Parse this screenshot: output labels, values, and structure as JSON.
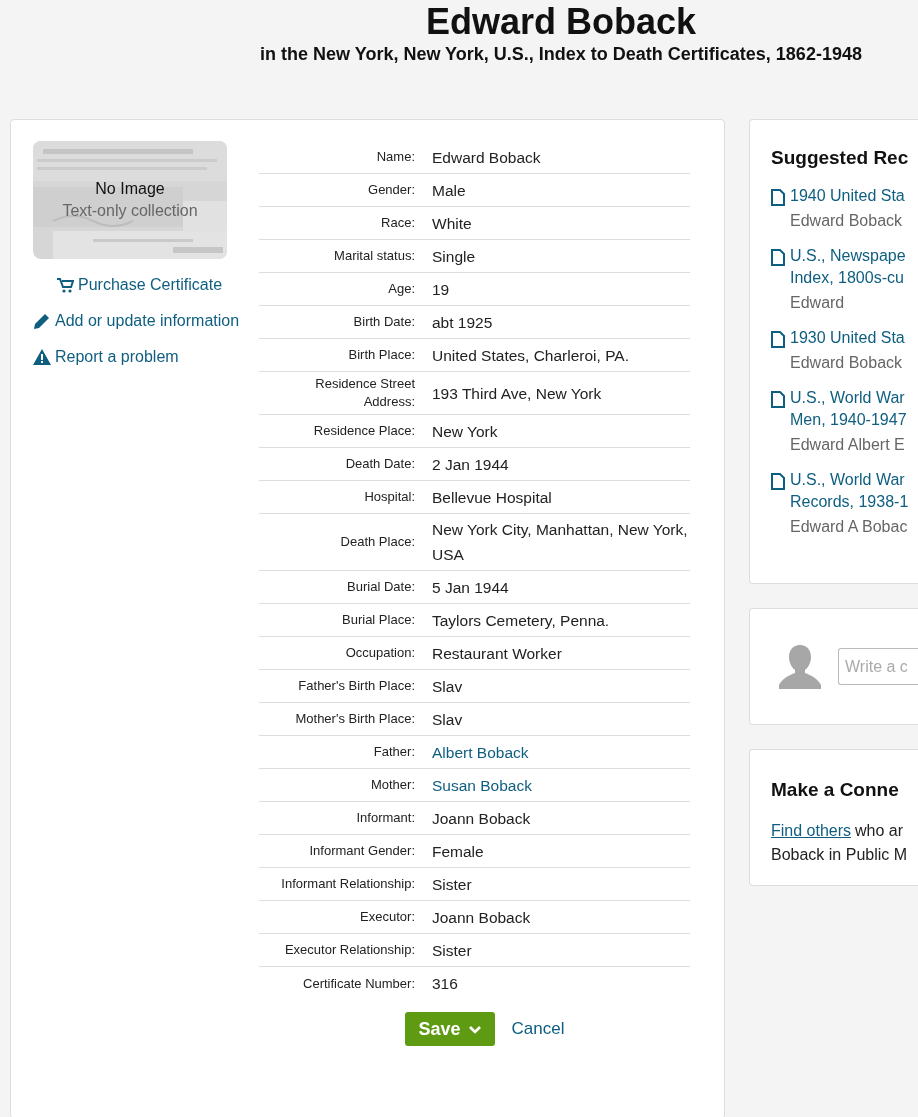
{
  "header": {
    "title": "Edward Boback",
    "subtitle": "in the New York, New York, U.S., Index to Death Certificates, 1862-1948"
  },
  "image": {
    "kind": "picture",
    "title": "No Image",
    "caption": "Text-only collection"
  },
  "actions": [
    {
      "label": "Purchase Certificate"
    },
    {
      "label": "Add or update information"
    },
    {
      "label": "Report a problem"
    }
  ],
  "fields": [
    {
      "label": "Name:",
      "value": "Edward Boback",
      "link": false
    },
    {
      "label": "Gender:",
      "value": "Male",
      "link": false
    },
    {
      "label": "Race:",
      "value": "White",
      "link": false
    },
    {
      "label": "Marital status:",
      "value": "Single",
      "link": false
    },
    {
      "label": "Age:",
      "value": "19",
      "link": false
    },
    {
      "label": "Birth Date:",
      "value": "abt 1925",
      "link": false
    },
    {
      "label": "Birth Place:",
      "value": "United States, Charleroi, PA.",
      "link": false
    },
    {
      "label": "Residence Street Address:",
      "value": "193 Third Ave, New York",
      "link": false
    },
    {
      "label": "Residence Place:",
      "value": "New York",
      "link": false
    },
    {
      "label": "Death Date:",
      "value": "2 Jan 1944",
      "link": false
    },
    {
      "label": "Hospital:",
      "value": "Bellevue Hospital",
      "link": false
    },
    {
      "label": "Death Place:",
      "value": "New York City, Manhattan, New York, USA",
      "link": false
    },
    {
      "label": "Burial Date:",
      "value": "5 Jan 1944",
      "link": false
    },
    {
      "label": "Burial Place:",
      "value": "Taylors Cemetery, Penna.",
      "link": false
    },
    {
      "label": "Occupation:",
      "value": "Restaurant Worker",
      "link": false
    },
    {
      "label": "Father's Birth Place:",
      "value": "Slav",
      "link": false
    },
    {
      "label": "Mother's Birth Place:",
      "value": "Slav",
      "link": false
    },
    {
      "label": "Father:",
      "value": "Albert Boback",
      "link": true
    },
    {
      "label": "Mother:",
      "value": "Susan Boback",
      "link": true
    },
    {
      "label": "Informant:",
      "value": "Joann Boback",
      "link": false
    },
    {
      "label": "Informant Gender:",
      "value": "Female",
      "link": false
    },
    {
      "label": "Informant Relationship:",
      "value": "Sister",
      "link": false
    },
    {
      "label": "Executor:",
      "value": "Joann Boback",
      "link": false
    },
    {
      "label": "Executor Relationship:",
      "value": "Sister",
      "link": false
    },
    {
      "label": "Certificate Number:",
      "value": "316",
      "link": false
    }
  ],
  "buttons": {
    "save": "Save",
    "cancel": "Cancel"
  },
  "suggested": {
    "title": "Suggested Rec",
    "records": [
      {
        "title_lines": [
          "1940 United Sta"
        ],
        "person": "Edward Boback"
      },
      {
        "title_lines": [
          "U.S., Newspape",
          "Index, 1800s-cu"
        ],
        "person": "Edward"
      },
      {
        "title_lines": [
          "1930 United Sta"
        ],
        "person": "Edward Boback"
      },
      {
        "title_lines": [
          "U.S., World War",
          "Men, 1940-1947"
        ],
        "person": "Edward Albert E"
      },
      {
        "title_lines": [
          "U.S., World War",
          "Records, 1938-1"
        ],
        "person": "Edward A Bobac"
      }
    ]
  },
  "comment": {
    "placeholder": "Write a c"
  },
  "connect": {
    "title": "Make a Conne",
    "link": "Find others",
    "text_1": "who ar",
    "text_2": "Boback in Public M"
  }
}
